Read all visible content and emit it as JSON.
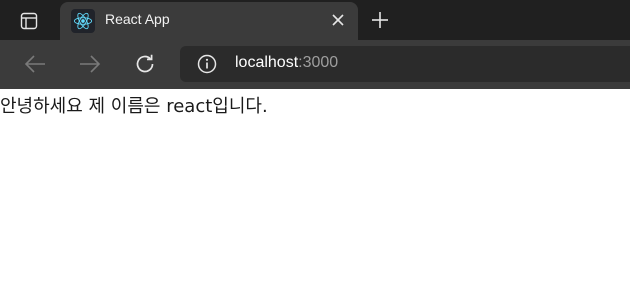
{
  "browser": {
    "tab": {
      "title": "React App",
      "favicon": "react-logo-icon"
    },
    "address_bar": {
      "host": "localhost",
      "port": ":3000"
    },
    "icons": {
      "tab_actions": "tab-actions-icon",
      "close": "close-icon",
      "new_tab": "plus-icon",
      "back": "back-arrow-icon",
      "forward": "forward-arrow-icon",
      "refresh": "refresh-icon",
      "info": "info-icon"
    },
    "colors": {
      "tab_bar": "#202020",
      "active_tab": "#3b3b3b",
      "address_bg": "#2b2b2b",
      "react_blue": "#61dafb"
    }
  },
  "page": {
    "text": "안녕하세요 제 이름은 react입니다."
  }
}
